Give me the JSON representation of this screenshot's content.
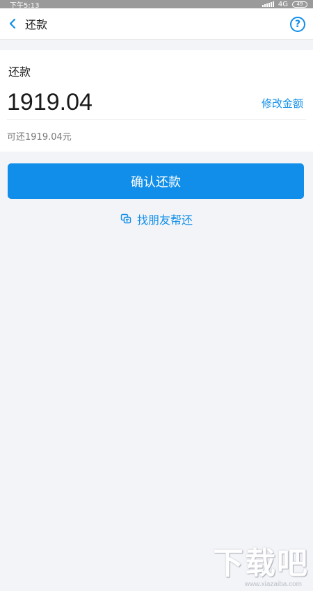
{
  "status_bar": {
    "time": "下午5:13",
    "network": "4G",
    "battery": "49"
  },
  "nav": {
    "title": "还款",
    "back_icon": "chevron-left-icon",
    "help_icon": "question-circle-icon",
    "help_glyph": "?"
  },
  "card": {
    "label": "还款",
    "amount": "1919.04",
    "modify_label": "修改金额",
    "available_text": "可还1919.04元"
  },
  "actions": {
    "confirm_label": "确认还款",
    "friend_label": "找朋友帮还",
    "friend_icon": "chat-bubble-icon"
  },
  "watermark": {
    "logo": "下载吧",
    "url": "www.xiazaiba.com"
  },
  "colors": {
    "accent": "#108ee9",
    "background": "#f3f4f8",
    "status_bar": "#9a9a9a"
  }
}
